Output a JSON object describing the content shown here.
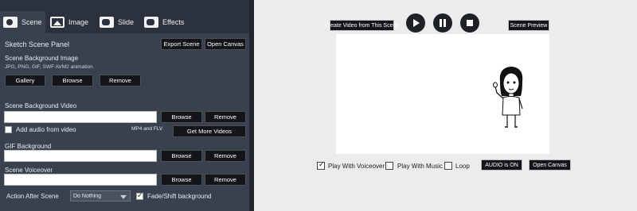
{
  "tabs": [
    {
      "label": "Scene",
      "icon": "scene-icon"
    },
    {
      "label": "Image",
      "icon": "image-icon"
    },
    {
      "label": "Slide",
      "icon": "slide-icon"
    },
    {
      "label": "Effects",
      "icon": "effects-icon"
    }
  ],
  "panel": {
    "title": "Sketch Scene Panel",
    "export_label": "Export Scene",
    "open_canvas_label": "Open Canvas",
    "bg_image_label": "Scene Background Image",
    "bg_image_formats": "JPG, PNG, GIF, SWF AVM2 animation",
    "gallery_label": "Gallery",
    "browse_label": "Browse",
    "remove_label": "Remove",
    "bg_video_label": "Scene Background Video",
    "bg_video_value": "",
    "add_audio_label": "Add audio from video",
    "video_formats": "MP4 and FLV",
    "get_more_videos_label": "Get More Videos",
    "gif_label": "GIF Background",
    "gif_value": "",
    "voiceover_label": "Scene Voiceover",
    "voiceover_value": "",
    "action_after_label": "Action After Scene",
    "action_after_value": "Do Nothing",
    "fade_label": "Fade/Shift background",
    "fade_checked": true,
    "add_audio_checked": false
  },
  "preview": {
    "create_video_label": "Create Video from This Scene",
    "scene_preview_label": "Scene Preview",
    "play_with_voiceover_label": "Play With Voiceover",
    "play_with_voiceover_checked": true,
    "play_with_music_label": "Play With Music",
    "play_with_music_checked": false,
    "loop_label": "Loop",
    "loop_checked": false,
    "audio_status_label": "AUDIO is ON",
    "open_canvas_label": "Open Canvas"
  },
  "colors": {
    "panel_bg": "#39414e",
    "tabbar_bg": "#2b323d",
    "button_bg": "#141519",
    "right_bg": "#ececec"
  }
}
